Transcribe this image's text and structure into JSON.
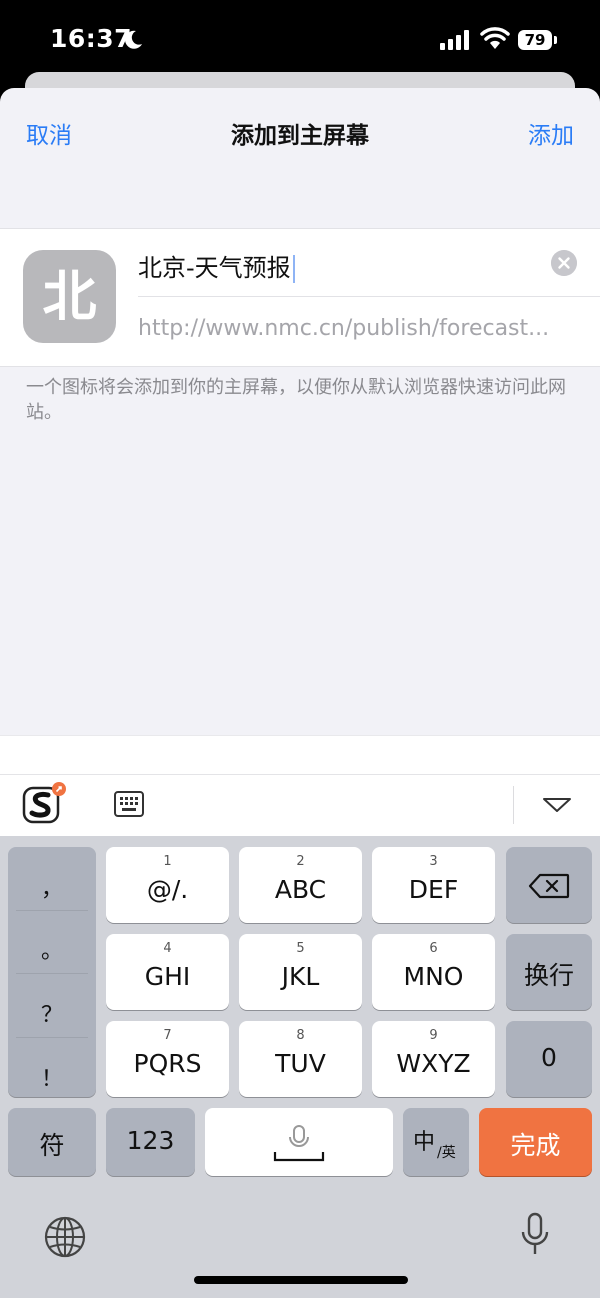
{
  "status": {
    "time": "16:37",
    "battery": "79"
  },
  "nav": {
    "cancel": "取消",
    "title": "添加到主屏幕",
    "add": "添加"
  },
  "app": {
    "icon_char": "北",
    "name": "北京-天气预报",
    "url": "http://www.nmc.cn/publish/forecast..."
  },
  "hint": "一个图标将会添加到你的主屏幕，以便你从默认浏览器快速访问此网站。",
  "keyboard": {
    "punctuation": [
      "，",
      "。",
      "？",
      "！"
    ],
    "keys": [
      {
        "num": "1",
        "label": "@/."
      },
      {
        "num": "2",
        "label": "ABC"
      },
      {
        "num": "3",
        "label": "DEF"
      },
      {
        "num": "4",
        "label": "GHI"
      },
      {
        "num": "5",
        "label": "JKL"
      },
      {
        "num": "6",
        "label": "MNO"
      },
      {
        "num": "7",
        "label": "PQRS"
      },
      {
        "num": "8",
        "label": "TUV"
      },
      {
        "num": "9",
        "label": "WXYZ"
      }
    ],
    "return_label": "换行",
    "zero_label": "0",
    "symbols_label": "符",
    "numbers_label": "123",
    "lang_main": "中",
    "lang_sub": "/英",
    "done_label": "完成",
    "done_color": "#f07341"
  },
  "accent_color": "#2a7cf6"
}
